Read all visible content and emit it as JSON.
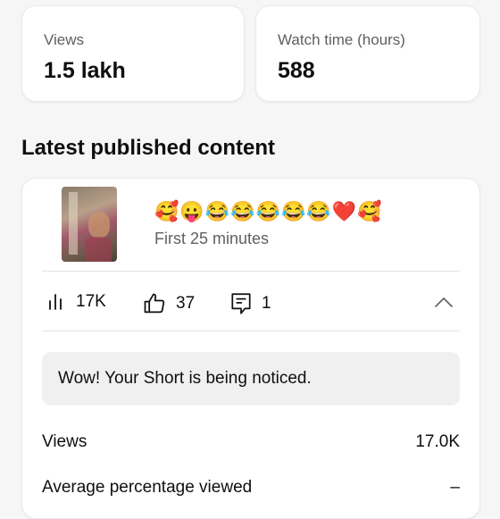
{
  "stats": [
    {
      "label": "Views",
      "value": "1.5 lakh"
    },
    {
      "label": "Watch time (hours)",
      "value": "588"
    }
  ],
  "section_title": "Latest published content",
  "content": {
    "title": "🥰😛😂😂😂😂😂❤️🥰",
    "subtitle": "First 25 minutes",
    "metrics": {
      "views": {
        "icon": "bar-chart-icon",
        "value": "17K"
      },
      "likes": {
        "icon": "thumbs-up-icon",
        "value": "37"
      },
      "comments": {
        "icon": "comment-icon",
        "value": "1"
      }
    },
    "notice": "Wow! Your Short is being noticed.",
    "rows": [
      {
        "label": "Views",
        "value": "17.0K"
      },
      {
        "label": "Average percentage viewed",
        "value": "–"
      }
    ]
  },
  "colors": {
    "background": "#f6f6f6",
    "card": "#ffffff",
    "secondary_text": "#606060",
    "notice_bg": "#f0f0f0"
  }
}
